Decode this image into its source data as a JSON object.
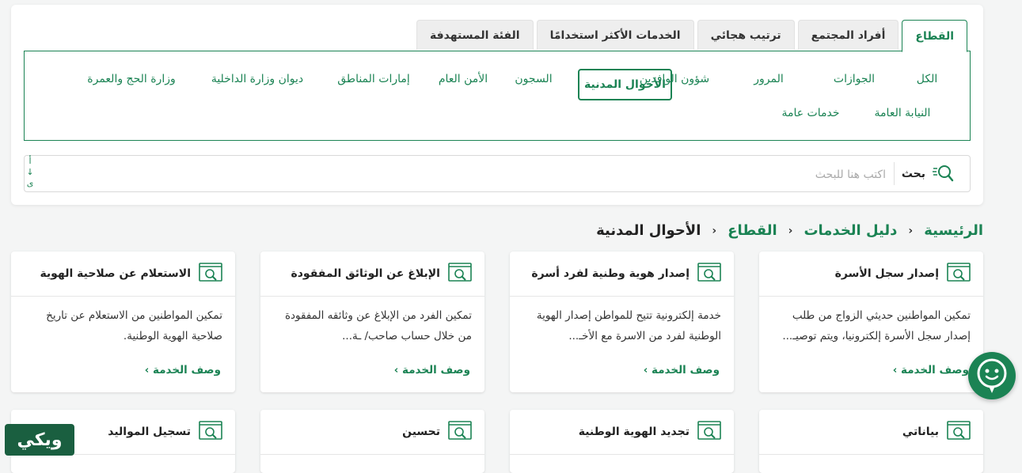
{
  "tabs": [
    {
      "label": "القطاع",
      "active": true
    },
    {
      "label": "أفراد المجتمع",
      "active": false
    },
    {
      "label": "ترتيب هجائي",
      "active": false
    },
    {
      "label": "الخدمات الأكثر استخدامًا",
      "active": false
    },
    {
      "label": "الفئة المستهدفة",
      "active": false
    }
  ],
  "categories": {
    "row1": [
      "الكل",
      "الجوازات",
      "المرور",
      "شؤون الوافدين",
      "الأحوال المدنية",
      "السجون",
      "الأمن العام",
      "إمارات المناطق",
      "ديوان وزارة الداخلية",
      "وزارة الحج والعمرة"
    ],
    "row2": [
      "النيابة العامة",
      "خدمات عامة"
    ],
    "selected": "الأحوال المدنية"
  },
  "search": {
    "label": "بحث",
    "placeholder": "اكتب هنا للبحث",
    "keyboard_hint": "أ ↓ ى"
  },
  "breadcrumb": {
    "home": "الرئيسية",
    "guide": "دليل الخدمات",
    "sector": "القطاع",
    "current": "الأحوال المدنية",
    "separator": "›"
  },
  "cards": [
    {
      "title": "إصدار سجل الأسرة",
      "desc": "تمكين المواطنين حديثي الزواج من طلب إصدار سجل الأسرة إلكترونيا، ويتم توصيـ...",
      "more": "وصف الخدمة ›"
    },
    {
      "title": "إصدار هوية وطنية لفرد أسرة",
      "desc": "خدمة إلكترونية تتيح للمواطن إصدار الهوية الوطنية لفرد من الاسرة مع الأخـ...",
      "more": "وصف الخدمة ›"
    },
    {
      "title": "الإبلاغ عن الوثائق المفقودة",
      "desc": "تمكين الفرد من الإبلاغ عن وثائقه المفقودة من خلال حساب صاحب/ ـة...",
      "more": "وصف الخدمة ›"
    },
    {
      "title": "الاستعلام عن صلاحية الهوية",
      "desc": "تمكين المواطنين من الاستعلام عن تاريخ صلاحية الهوية الوطنية.",
      "more": "وصف الخدمة ›"
    },
    {
      "title": "بياناتي"
    },
    {
      "title": "تجديد الهوية الوطنية"
    },
    {
      "title": "تحسين"
    },
    {
      "title": "تسجيل المواليد"
    }
  ],
  "watermark": "ويكي",
  "colors": {
    "accent": "#1b8354",
    "background": "#f4f5f5"
  }
}
